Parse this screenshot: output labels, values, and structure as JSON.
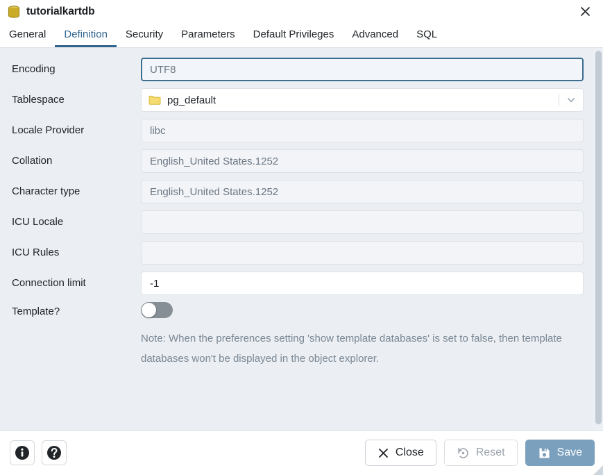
{
  "titlebar": {
    "icon": "database-icon",
    "title": "tutorialkartdb",
    "close_icon": "close-icon"
  },
  "tabs": [
    {
      "label": "General",
      "active": false
    },
    {
      "label": "Definition",
      "active": true
    },
    {
      "label": "Security",
      "active": false
    },
    {
      "label": "Parameters",
      "active": false
    },
    {
      "label": "Default Privileges",
      "active": false
    },
    {
      "label": "Advanced",
      "active": false
    },
    {
      "label": "SQL",
      "active": false
    }
  ],
  "form": {
    "encoding": {
      "label": "Encoding",
      "value": "UTF8"
    },
    "tablespace": {
      "label": "Tablespace",
      "value": "pg_default",
      "icon": "folder-icon",
      "dropdown_icon": "chevron-down-icon"
    },
    "locale_provider": {
      "label": "Locale Provider",
      "value": "libc"
    },
    "collation": {
      "label": "Collation",
      "value": "English_United States.1252"
    },
    "character_type": {
      "label": "Character type",
      "value": "English_United States.1252"
    },
    "icu_locale": {
      "label": "ICU Locale",
      "value": ""
    },
    "icu_rules": {
      "label": "ICU Rules",
      "value": ""
    },
    "connection_limit": {
      "label": "Connection limit",
      "value": "-1"
    },
    "template": {
      "label": "Template?",
      "value": "off"
    },
    "note": "Note: When the preferences setting 'show template databases' is set to false, then template databases won't be displayed in the object explorer."
  },
  "footer": {
    "info_icon": "info-icon",
    "help_icon": "help-icon",
    "close_label": "Close",
    "close_icon": "close-x-icon",
    "reset_label": "Reset",
    "reset_icon": "reset-icon",
    "save_label": "Save",
    "save_icon": "floppy-disk-icon"
  },
  "colors": {
    "accent": "#326690",
    "primary_button": "#7ba0bd",
    "panel_bg": "#ebeef2",
    "db_icon": "#c8a930",
    "folder_icon": "#f2d65c"
  }
}
